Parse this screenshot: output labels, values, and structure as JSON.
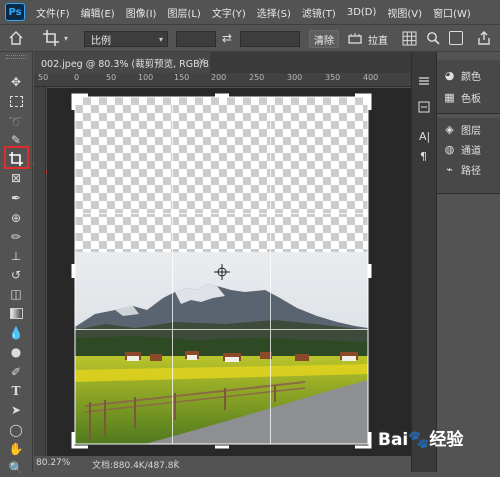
{
  "app": {
    "logo": "Ps"
  },
  "menu": [
    "文件(F)",
    "编辑(E)",
    "图像(I)",
    "图层(L)",
    "文字(Y)",
    "选择(S)",
    "滤镜(T)",
    "3D(D)",
    "视图(V)",
    "窗口(W)"
  ],
  "options": {
    "ratio_label": "比例",
    "swap_icon": "⇄",
    "clear_label": "清除",
    "straighten_label": "拉直"
  },
  "document": {
    "tab_title": "002.jpeg @ 80.3% (裁剪预览, RGB/8) *",
    "close": "×"
  },
  "ruler": {
    "top_ticks": [
      "50",
      "0",
      "50",
      "100",
      "150",
      "200",
      "250",
      "300",
      "350",
      "400"
    ]
  },
  "status": {
    "zoom": "80.27%",
    "doc_info": "文档:880.4K/487.8K",
    "arrow": "›"
  },
  "panels": {
    "group1": [
      {
        "icon": "palette-icon",
        "glyph": "◕",
        "label": "颜色"
      },
      {
        "icon": "swatches-icon",
        "glyph": "▦",
        "label": "色板"
      }
    ],
    "group2": [
      {
        "icon": "layers-icon",
        "glyph": "◈",
        "label": "图层"
      },
      {
        "icon": "channels-icon",
        "glyph": "◍",
        "label": "通道"
      },
      {
        "icon": "paths-icon",
        "glyph": "⌁",
        "label": "路径"
      }
    ],
    "strip_glyphs": [
      "A|",
      "¶"
    ]
  },
  "watermark": {
    "text": "Bai🐾经验"
  },
  "colors": {
    "highlight": "#e32b2b",
    "ps_blue": "#31a8ff",
    "ui_bg": "#535353",
    "canvas_bg": "#282828"
  }
}
